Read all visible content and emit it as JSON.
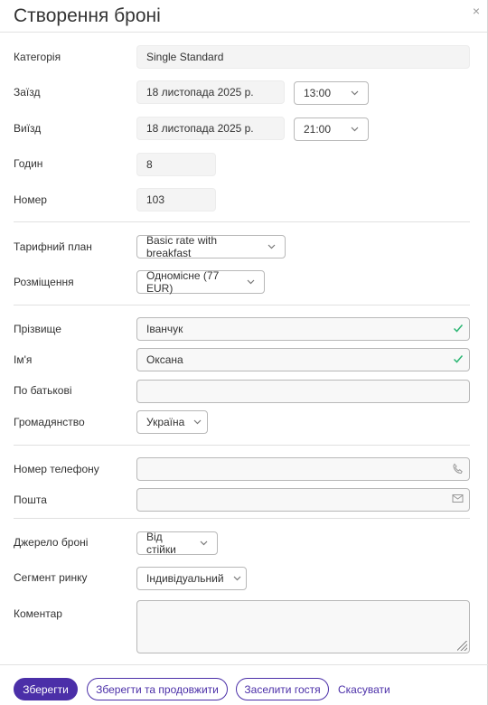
{
  "title": "Створення броні",
  "close_icon": "×",
  "labels": {
    "category": "Категорія",
    "checkin": "Заїзд",
    "checkout": "Виїзд",
    "hours": "Годин",
    "room": "Номер",
    "rate_plan": "Тарифний план",
    "accommodation": "Розміщення",
    "surname": "Прізвище",
    "name": "Ім'я",
    "patronymic": "По батькові",
    "citizenship": "Громадянство",
    "phone": "Номер телефону",
    "email": "Пошта",
    "source": "Джерело броні",
    "segment": "Сегмент ринку",
    "comment": "Коментар"
  },
  "values": {
    "category": "Single Standard",
    "checkin_date": "18 листопада 2025 р.",
    "checkin_time": "13:00",
    "checkout_date": "18 листопада 2025 р.",
    "checkout_time": "21:00",
    "hours": "8",
    "room": "103",
    "rate_plan": "Basic rate with breakfast",
    "accommodation": "Одномісне (77 EUR)",
    "surname": "Іванчук",
    "name": "Оксана",
    "patronymic": "",
    "citizenship": "Україна",
    "phone": "",
    "email": "",
    "source": "Від стійки",
    "segment": "Індивідуальний",
    "comment": ""
  },
  "footer": {
    "save": "Зберегти",
    "save_continue": "Зберегти та продовжити",
    "check_in_guest": "Заселити гостя",
    "cancel": "Скасувати"
  },
  "colors": {
    "accent": "#4b2fa8",
    "valid": "#2bb673"
  },
  "icons": [
    "close-icon",
    "chevron-down-icon",
    "check-icon",
    "phone-icon",
    "envelope-icon",
    "resize-grip-icon"
  ]
}
